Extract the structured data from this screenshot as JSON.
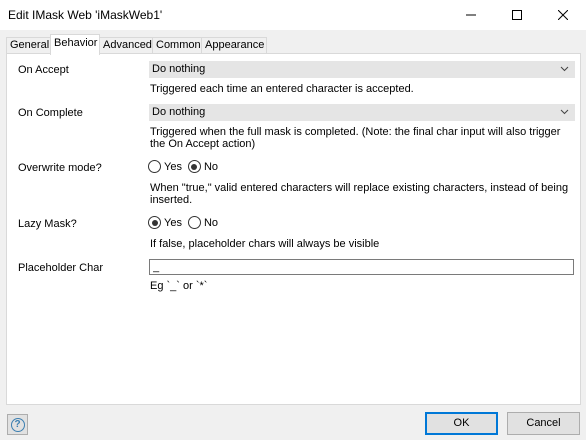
{
  "window": {
    "title": "Edit IMask Web 'iMaskWeb1'"
  },
  "tabs": [
    {
      "label": "General"
    },
    {
      "label": "Behavior"
    },
    {
      "label": "Advanced"
    },
    {
      "label": "Common"
    },
    {
      "label": "Appearance"
    }
  ],
  "active_tab": "Behavior",
  "fields": {
    "on_accept": {
      "label": "On Accept",
      "value": "Do nothing",
      "description": "Triggered each time an entered character is accepted."
    },
    "on_complete": {
      "label": "On Complete",
      "value": "Do nothing",
      "description": "Triggered when the full mask is completed. (Note: the final char input will also trigger the On Accept action)"
    },
    "overwrite_mode": {
      "label": "Overwrite mode?",
      "yes_label": "Yes",
      "no_label": "No",
      "selected": "No",
      "description": "When \"true,\" valid entered characters will replace existing characters, instead of being inserted."
    },
    "lazy_mask": {
      "label": "Lazy Mask?",
      "yes_label": "Yes",
      "no_label": "No",
      "selected": "Yes",
      "description": "If false, placeholder chars will always be visible"
    },
    "placeholder_char": {
      "label": "Placeholder Char",
      "value": "_",
      "description": "Eg `_` or `*`"
    }
  },
  "footer": {
    "help_glyph": "?",
    "ok_label": "OK",
    "cancel_label": "Cancel"
  },
  "colors": {
    "accent": "#0078d7",
    "select_bg": "#e5e5e5",
    "panel_bg": "#ffffff",
    "dialog_bg": "#f0f0f0"
  }
}
